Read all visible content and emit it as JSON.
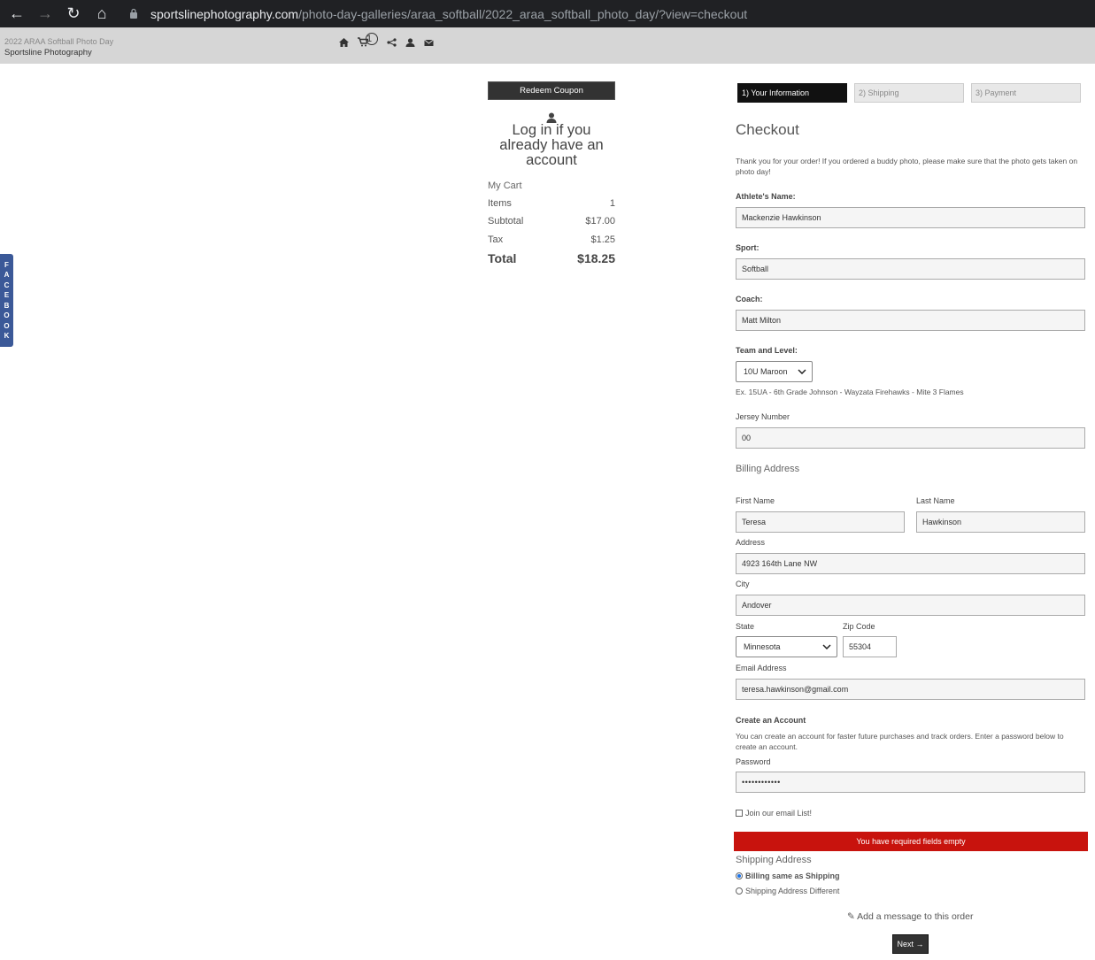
{
  "browser": {
    "url_host": "sportslinephotography.com",
    "url_path": "/photo-day-galleries/araa_softball/2022_araa_softball_photo_day/?view=checkout"
  },
  "site": {
    "event": "2022 ARAA Softball Photo Day",
    "name": "Sportsline Photography",
    "cart_count": "1"
  },
  "facebook_tab": [
    "F",
    "A",
    "C",
    "E",
    "B",
    "O",
    "O",
    "K"
  ],
  "cart": {
    "coupon_label": "Redeem Coupon",
    "login_text": "Log in if you already have an account",
    "title": "My Cart",
    "rows": [
      {
        "label": "Items",
        "value": "1"
      },
      {
        "label": "Subtotal",
        "value": "$17.00"
      },
      {
        "label": "Tax",
        "value": "$1.25"
      }
    ],
    "total_label": "Total",
    "total_value": "$18.25"
  },
  "steps": [
    "1) Your Information",
    "2) Shipping",
    "3) Payment"
  ],
  "form": {
    "heading": "Checkout",
    "intro": "Thank you for your order!  If you ordered a buddy photo, please make sure that the photo gets taken on photo day!",
    "athlete_label": "Athlete's Name:",
    "athlete_value": "Mackenzie Hawkinson",
    "sport_label": "Sport:",
    "sport_value": "Softball",
    "coach_label": "Coach:",
    "coach_value": "Matt Milton",
    "team_label": "Team and Level:",
    "team_value": "10U Maroon",
    "team_hint": "Ex. 15UA - 6th Grade Johnson - Wayzata Firehawks - Mite 3 Flames",
    "jersey_label": "Jersey Number",
    "jersey_value": "00",
    "billing_heading": "Billing Address",
    "first_label": "First Name",
    "first_value": "Teresa",
    "last_label": "Last Name",
    "last_value": "Hawkinson",
    "address_label": "Address",
    "address_value": "4923 164th Lane NW",
    "city_label": "City",
    "city_value": "Andover",
    "state_label": "State",
    "state_value": "Minnesota",
    "zip_label": "Zip Code",
    "zip_value": "55304",
    "email_label": "Email Address",
    "email_value": "teresa.hawkinson@gmail.com",
    "account_heading": "Create an Account",
    "account_desc": "You can create an account for faster future purchases and track orders. Enter a password below to create an account.",
    "password_label": "Password",
    "password_value": "••••••••••••",
    "email_list_label": "Join our email List!",
    "error": "You have required fields empty",
    "shipping_heading": "Shipping Address",
    "ship_same": "Billing same as Shipping",
    "ship_diff": "Shipping Address Different",
    "add_message": "Add a message to this order",
    "next_label": "Next →"
  }
}
